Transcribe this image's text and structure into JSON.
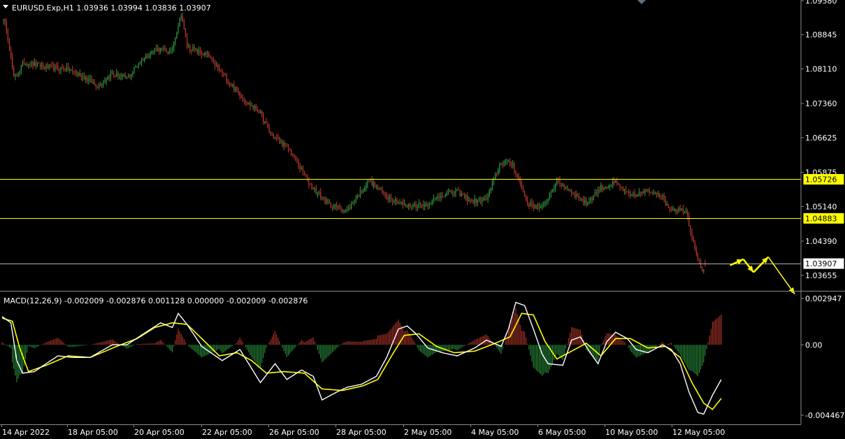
{
  "header": {
    "symbol_line": "EURUSD.Exp,H1  1.03936 1.03994 1.03836 1.03907",
    "macd_line": "MACD(12,26,9) -0.002009 -0.002876 0.001128 0.000000 -0.002009 -0.002876"
  },
  "colors": {
    "background": "#000000",
    "up_candle": "#2ea043",
    "down_candle": "#c23a2e",
    "level_line": "#ffff00",
    "current_line": "#b0b0b0",
    "macd_line": "#ffffff",
    "signal_line": "#ffff00",
    "hist_pos": "#c23a2e",
    "hist_neg": "#2ea043",
    "forecast_arrow": "#ffff00",
    "axis_text": "#ffffff"
  },
  "chart_data": [
    {
      "type": "candlestick",
      "title": "EURUSD.Exp,H1",
      "ohlc_last": {
        "open": 1.03936,
        "high": 1.03994,
        "low": 1.03836,
        "close": 1.03907
      },
      "ylim": [
        1.0335,
        1.0958
      ],
      "y_ticks": [
        1.0958,
        1.08845,
        1.0811,
        1.0736,
        1.06625,
        1.05875,
        1.0514,
        1.0439,
        1.03655
      ],
      "y_tick_labels": [
        "1.09580",
        "1.08845",
        "1.08110",
        "1.07360",
        "1.06625",
        "1.05875",
        "1.05140",
        "1.04390",
        "1.03655"
      ],
      "x_tick_labels": [
        "14 Apr 2022",
        "18 Apr 05:00",
        "20 Apr 05:00",
        "22 Apr 05:00",
        "26 Apr 05:00",
        "28 Apr 05:00",
        "2 May 05:00",
        "4 May 05:00",
        "6 May 05:00",
        "10 May 05:00",
        "12 May 05:00"
      ],
      "bars": 480,
      "close_path": [
        [
          0,
          1.092
        ],
        [
          3,
          1.09
        ],
        [
          8,
          1.079
        ],
        [
          15,
          1.0825
        ],
        [
          30,
          1.0815
        ],
        [
          45,
          1.081
        ],
        [
          55,
          1.0795
        ],
        [
          65,
          1.0775
        ],
        [
          75,
          1.08
        ],
        [
          85,
          1.079
        ],
        [
          95,
          1.083
        ],
        [
          105,
          1.0855
        ],
        [
          115,
          1.0845
        ],
        [
          122,
          1.093
        ],
        [
          126,
          1.086
        ],
        [
          135,
          1.0845
        ],
        [
          140,
          1.084
        ],
        [
          150,
          1.08
        ],
        [
          158,
          1.077
        ],
        [
          168,
          1.0735
        ],
        [
          175,
          1.072
        ],
        [
          183,
          1.067
        ],
        [
          195,
          1.064
        ],
        [
          210,
          1.056
        ],
        [
          222,
          1.052
        ],
        [
          235,
          1.0505
        ],
        [
          250,
          1.057
        ],
        [
          260,
          1.054
        ],
        [
          275,
          1.0515
        ],
        [
          290,
          1.052
        ],
        [
          300,
          1.054
        ],
        [
          310,
          1.0545
        ],
        [
          320,
          1.0525
        ],
        [
          330,
          1.053
        ],
        [
          340,
          1.061
        ],
        [
          348,
          1.0605
        ],
        [
          358,
          1.052
        ],
        [
          368,
          1.051
        ],
        [
          378,
          1.057
        ],
        [
          388,
          1.0545
        ],
        [
          398,
          1.052
        ],
        [
          408,
          1.0555
        ],
        [
          418,
          1.0565
        ],
        [
          428,
          1.0535
        ],
        [
          437,
          1.0545
        ],
        [
          447,
          1.0545
        ],
        [
          455,
          1.051
        ],
        [
          466,
          1.0505
        ],
        [
          470,
          1.045
        ],
        [
          476,
          1.038
        ],
        [
          480,
          1.0373
        ],
        [
          486,
          1.0392
        ],
        [
          492,
          1.0396
        ],
        [
          495,
          1.0391
        ]
      ],
      "levels": [
        {
          "value": 1.05726,
          "label": "1.05726"
        },
        {
          "value": 1.04883,
          "label": "1.04883"
        }
      ],
      "current_price": {
        "value": 1.03907,
        "label": "1.03907"
      },
      "forecast_path": [
        [
          496,
          1.0387
        ],
        [
          505,
          1.04
        ],
        [
          512,
          1.0372
        ],
        [
          522,
          1.0405
        ],
        [
          540,
          1.0325
        ]
      ]
    },
    {
      "type": "macd",
      "title": "MACD(12,26,9)",
      "ylim": [
        -0.00505,
        0.0033
      ],
      "y_ticks": [
        0.002947,
        0.0,
        -0.004467
      ],
      "y_tick_labels": [
        "0.002947",
        "0.00",
        "-0.004467"
      ],
      "macd_path": [
        [
          0,
          0.0018
        ],
        [
          6,
          0.0014
        ],
        [
          10,
          -0.001
        ],
        [
          14,
          -0.0018
        ],
        [
          22,
          -0.0017
        ],
        [
          38,
          -0.0007
        ],
        [
          48,
          -0.0008
        ],
        [
          60,
          -0.0008
        ],
        [
          75,
          0.0
        ],
        [
          85,
          0.0
        ],
        [
          98,
          0.0008
        ],
        [
          108,
          0.0014
        ],
        [
          116,
          0.0011
        ],
        [
          120,
          0.002
        ],
        [
          126,
          0.0013
        ],
        [
          136,
          -0.0001
        ],
        [
          150,
          -0.001
        ],
        [
          162,
          -0.0003
        ],
        [
          168,
          -0.0012
        ],
        [
          176,
          -0.0024
        ],
        [
          186,
          -0.0012
        ],
        [
          194,
          -0.0022
        ],
        [
          204,
          -0.0016
        ],
        [
          212,
          -0.002
        ],
        [
          218,
          -0.0035
        ],
        [
          228,
          -0.003
        ],
        [
          235,
          -0.0027
        ],
        [
          245,
          -0.0025
        ],
        [
          255,
          -0.002
        ],
        [
          262,
          -0.0008
        ],
        [
          270,
          0.001
        ],
        [
          276,
          0.0012
        ],
        [
          282,
          0.0007
        ],
        [
          290,
          -0.0002
        ],
        [
          300,
          -0.0005
        ],
        [
          310,
          -0.0007
        ],
        [
          322,
          -0.0002
        ],
        [
          330,
          0.0003
        ],
        [
          340,
          -0.0001
        ],
        [
          345,
          0.001
        ],
        [
          350,
          0.0027
        ],
        [
          356,
          0.0025
        ],
        [
          362,
          0.001
        ],
        [
          368,
          -0.0006
        ],
        [
          372,
          -0.0012
        ],
        [
          382,
          -0.0013
        ],
        [
          388,
          0.0003
        ],
        [
          394,
          0.0005
        ],
        [
          400,
          -0.0004
        ],
        [
          406,
          -0.0012
        ],
        [
          412,
          0.0002
        ],
        [
          418,
          0.0008
        ],
        [
          426,
          0.0004
        ],
        [
          432,
          -0.0003
        ],
        [
          440,
          -0.0005
        ],
        [
          450,
          0.0
        ],
        [
          456,
          -0.0003
        ],
        [
          462,
          -0.0012
        ],
        [
          468,
          -0.003
        ],
        [
          474,
          -0.0043
        ],
        [
          478,
          -0.0044
        ],
        [
          484,
          -0.0032
        ],
        [
          490,
          -0.0022
        ]
      ],
      "signal_path": [
        [
          0,
          0.0017
        ],
        [
          7,
          0.0015
        ],
        [
          12,
          -0.0002
        ],
        [
          18,
          -0.0017
        ],
        [
          30,
          -0.0013
        ],
        [
          45,
          -0.0007
        ],
        [
          60,
          -0.0008
        ],
        [
          78,
          -0.0001
        ],
        [
          92,
          0.0004
        ],
        [
          104,
          0.0011
        ],
        [
          116,
          0.0014
        ],
        [
          126,
          0.0013
        ],
        [
          136,
          0.0004
        ],
        [
          148,
          -0.0007
        ],
        [
          160,
          -0.0005
        ],
        [
          170,
          -0.001
        ],
        [
          180,
          -0.0018
        ],
        [
          192,
          -0.0017
        ],
        [
          206,
          -0.0018
        ],
        [
          218,
          -0.0028
        ],
        [
          232,
          -0.0029
        ],
        [
          246,
          -0.0026
        ],
        [
          256,
          -0.0022
        ],
        [
          266,
          -0.0006
        ],
        [
          274,
          0.0006
        ],
        [
          284,
          0.0007
        ],
        [
          296,
          -0.0001
        ],
        [
          308,
          -0.0005
        ],
        [
          322,
          -0.0004
        ],
        [
          336,
          0.0001
        ],
        [
          346,
          0.0005
        ],
        [
          354,
          0.002
        ],
        [
          362,
          0.0019
        ],
        [
          370,
          0.0002
        ],
        [
          378,
          -0.0009
        ],
        [
          388,
          -0.0004
        ],
        [
          398,
          0.0001
        ],
        [
          408,
          -0.0007
        ],
        [
          418,
          0.0004
        ],
        [
          428,
          0.0004
        ],
        [
          440,
          -0.0002
        ],
        [
          452,
          -0.0001
        ],
        [
          462,
          -0.0008
        ],
        [
          470,
          -0.0024
        ],
        [
          478,
          -0.0037
        ],
        [
          484,
          -0.0041
        ],
        [
          490,
          -0.0034
        ]
      ],
      "forecast_path": []
    }
  ]
}
